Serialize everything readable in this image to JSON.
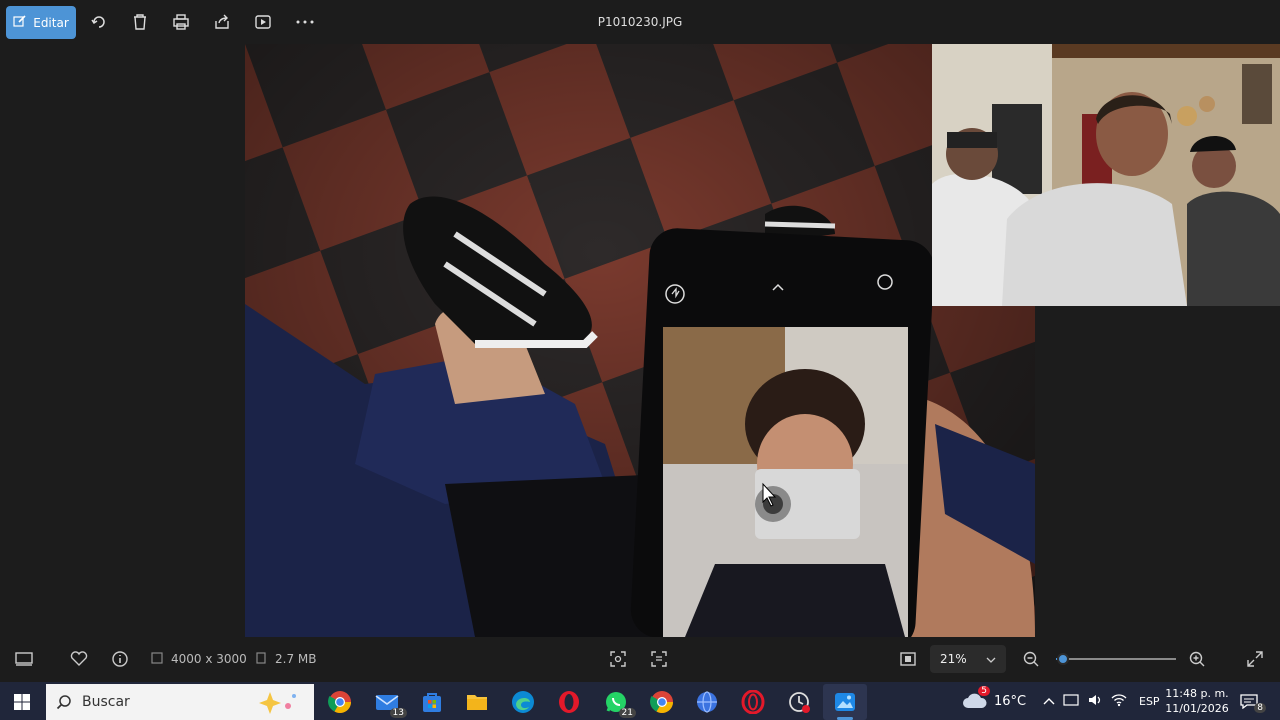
{
  "window": {
    "title": "P1010230.JPG",
    "edit_label": "Editar"
  },
  "toolbar_icons": [
    "edit-icon",
    "rotate-icon",
    "delete-icon",
    "print-icon",
    "share-icon",
    "slideshow-icon",
    "more-icon"
  ],
  "status": {
    "dimensions": "4000 x 3000",
    "file_size": "2.7 MB",
    "zoom": "21%"
  },
  "taskbar": {
    "search_placeholder": "Buscar",
    "mail_badge": "13",
    "whatsapp_badge": "21",
    "weather_badge": "5",
    "temperature": "16°C",
    "language": "ESP",
    "time": "11:48 p. m.",
    "date": "11/01/2026",
    "notification_badge": "8"
  },
  "colors": {
    "accent": "#4d94d6",
    "background": "#1c1c1c",
    "taskbar": "#20263a"
  },
  "zoom_slider_level": 0.06
}
